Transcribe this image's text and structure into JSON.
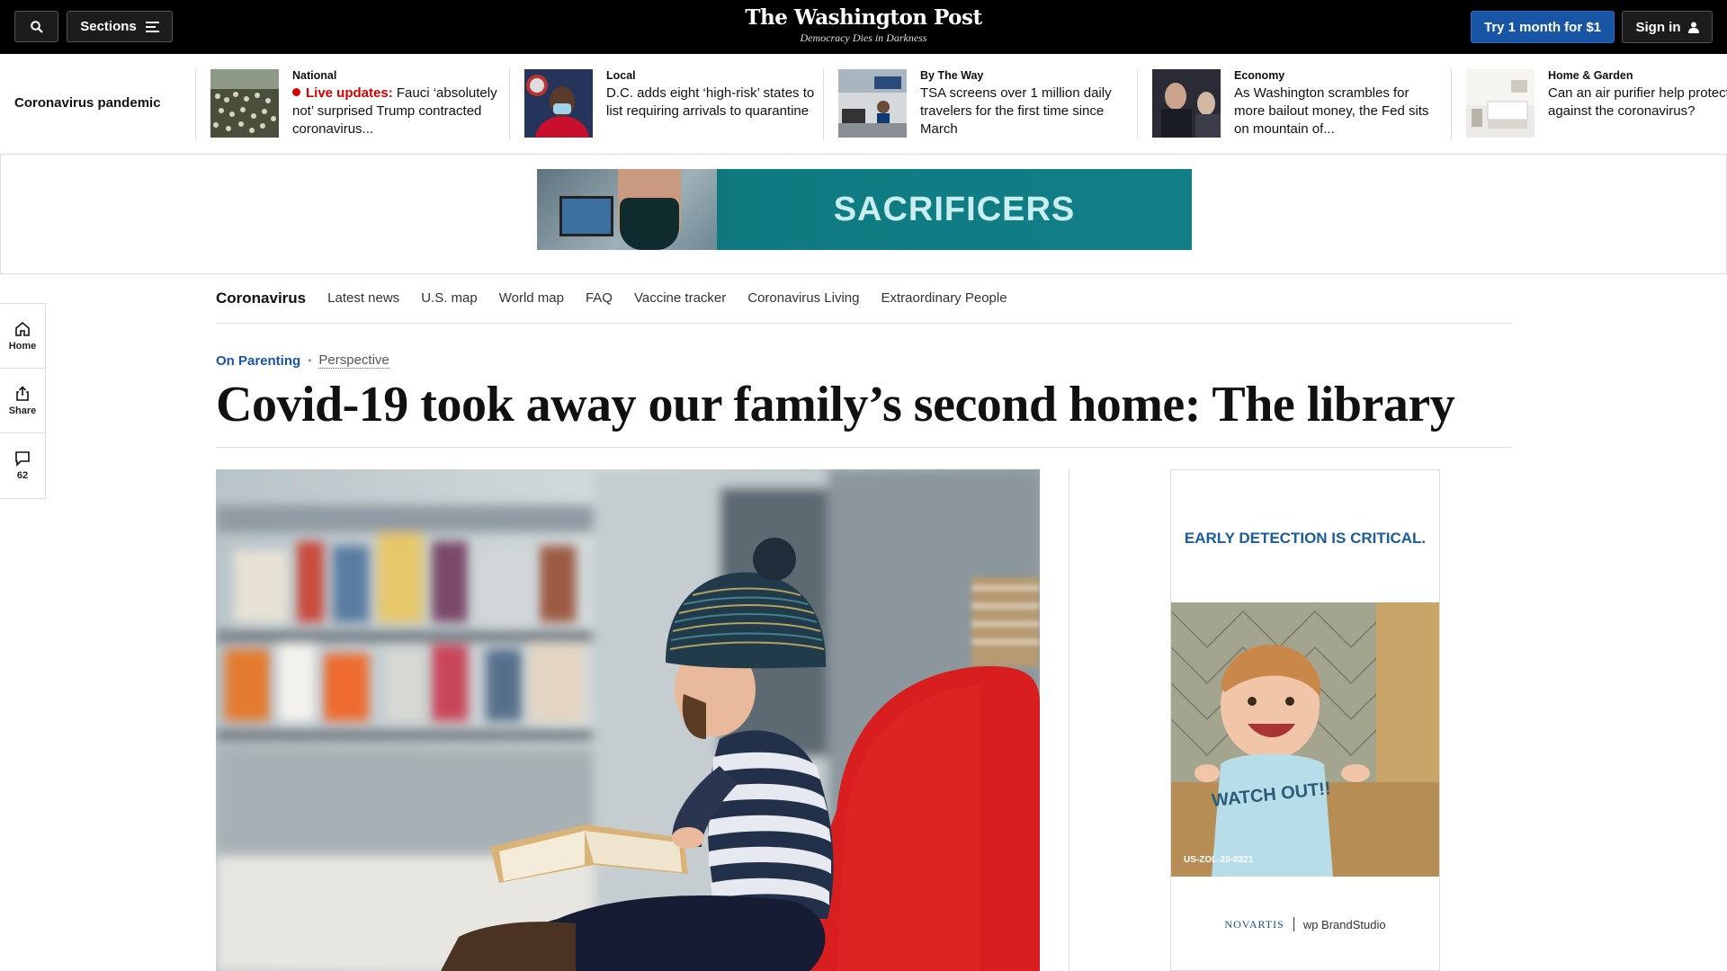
{
  "header": {
    "sections_label": "Sections",
    "logo": "The Washington Post",
    "tagline": "Democracy Dies in Darkness",
    "try_label": "Try 1 month for $1",
    "signin_label": "Sign in"
  },
  "strip": {
    "label": "Coronavirus pandemic",
    "items": [
      {
        "kicker": "National",
        "live": "Live updates:",
        "headline": "Fauci ‘absolutely not’ surprised Trump contracted coronavirus..."
      },
      {
        "kicker": "Local",
        "headline": "D.C. adds eight ‘high-risk’ states to list requiring arrivals to quarantine"
      },
      {
        "kicker": "By The Way",
        "headline": "TSA screens over 1 million daily travelers for the first time since March"
      },
      {
        "kicker": "Economy",
        "headline": "As Washington scrambles for more bailout money, the Fed sits on mountain of..."
      },
      {
        "kicker": "Home & Garden",
        "headline": "Can an air purifier help protect you against the coronavirus?"
      }
    ]
  },
  "ad_banner": {
    "text": "SACRIFICERS"
  },
  "section_nav": {
    "title": "Coronavirus",
    "links": [
      "Latest news",
      "U.S. map",
      "World map",
      "FAQ",
      "Vaccine tracker",
      "Coronavirus Living",
      "Extraordinary People"
    ]
  },
  "rail": {
    "home_label": "Home",
    "share_label": "Share",
    "comments_count": "62"
  },
  "article": {
    "section": "On Parenting",
    "type": "Perspective",
    "headline": "Covid-19 took away our family’s second home: The library"
  },
  "side_ad": {
    "headline": "EARLY DETECTION IS CRITICAL.",
    "shirt_text": "WATCH OUT!!",
    "code": "US-ZOL-20-0321",
    "sponsor": "NOVARTIS",
    "brand": "wp BrandStudio"
  },
  "colors": {
    "accent_blue": "#1955a5",
    "live_red": "#d20000",
    "chair_red": "#d81e1e"
  }
}
